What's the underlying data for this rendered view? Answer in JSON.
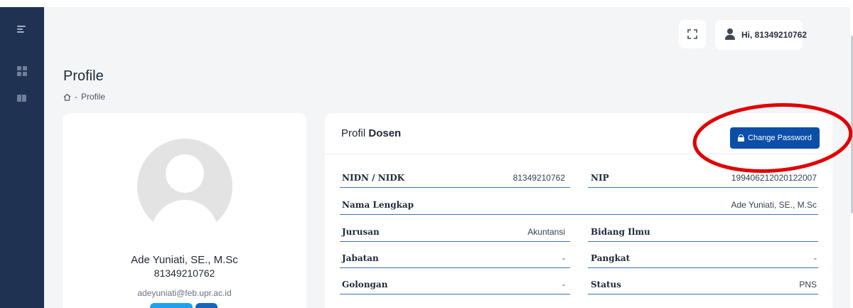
{
  "topbar": {
    "greeting": "Hi, 81349210762"
  },
  "page": {
    "title": "Profile",
    "breadcrumb_separator": "-",
    "breadcrumb_current": "Profile"
  },
  "profile_card": {
    "name": "Ade Yuniati, SE., M.Sc",
    "id": "81349210762",
    "email": "adeyuniati@feb.upr.ac.id"
  },
  "detail": {
    "title_prefix": "Profil",
    "title_bold": "Dosen",
    "change_password_label": "Change Password",
    "fields": {
      "nidn_label": "NIDN / NIDK",
      "nidn_value": "81349210762",
      "nip_label": "NIP",
      "nip_value": "199406212020122007",
      "nama_label": "Nama Lengkap",
      "nama_value": "Ade Yuniati, SE., M.Sc",
      "jurusan_label": "Jurusan",
      "jurusan_value": "Akuntansi",
      "bidang_label": "Bidang Ilmu",
      "bidang_value": "",
      "jabatan_label": "Jabatan",
      "jabatan_value": "-",
      "pangkat_label": "Pangkat",
      "pangkat_value": "-",
      "golongan_label": "Golongan",
      "golongan_value": "-",
      "status_label": "Status",
      "status_value": "PNS"
    }
  },
  "icons": {
    "sidebar": [
      "menu-icon",
      "dashboard-icon",
      "book-icon"
    ],
    "topbar": [
      "fullscreen-icon",
      "user-icon"
    ],
    "breadcrumb": "home-icon",
    "button": "lock-icon"
  },
  "colors": {
    "sidebar": "#1f3251",
    "primary_button": "#0b4fa8",
    "row_underline": "#3b6fb8",
    "annotation": "#e10000"
  }
}
